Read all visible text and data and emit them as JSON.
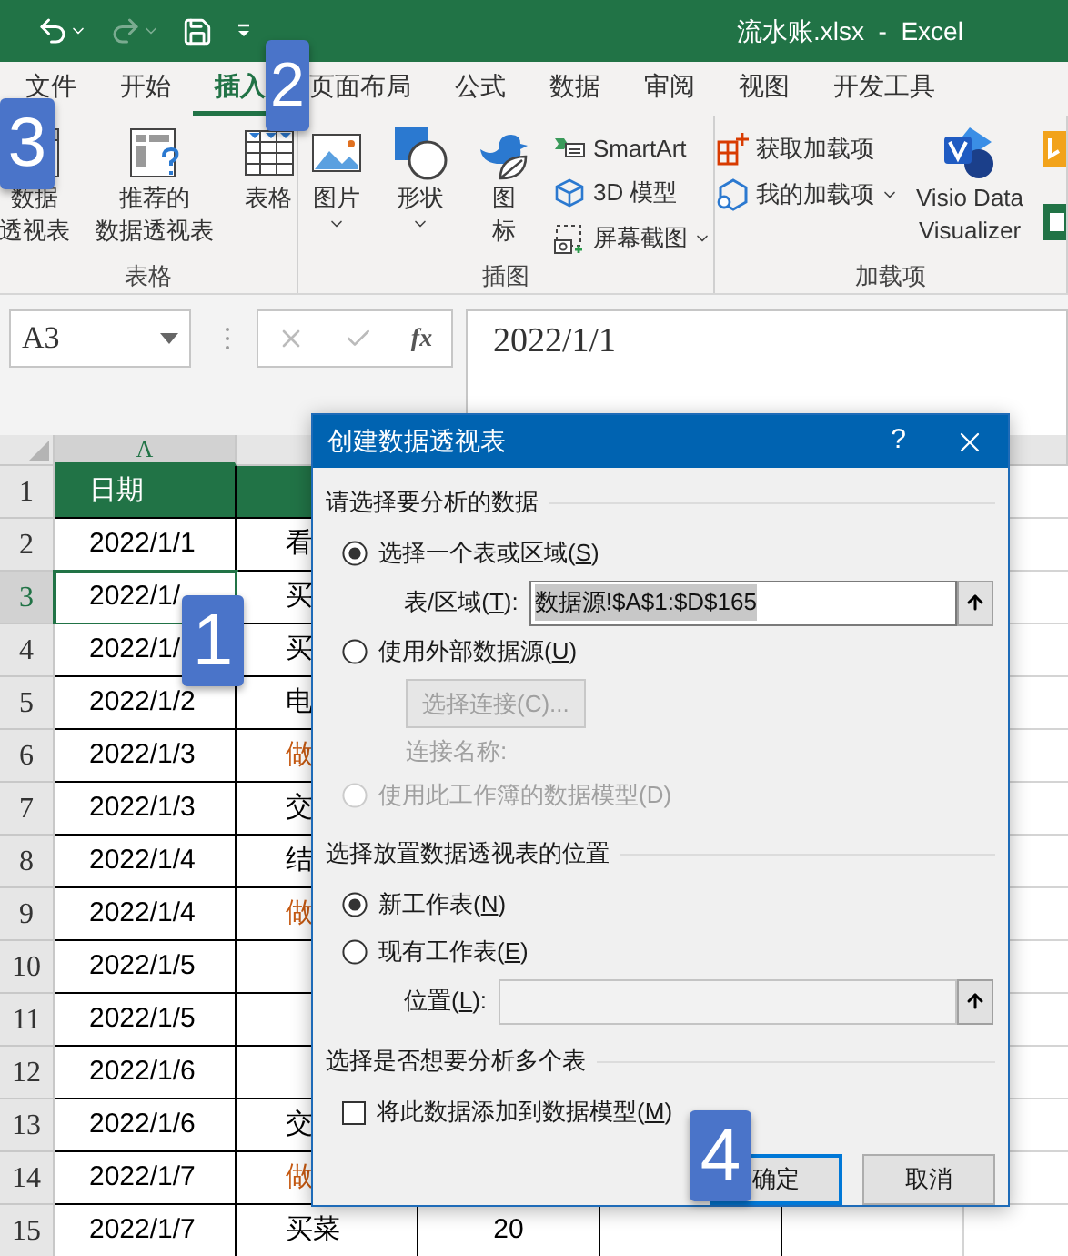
{
  "title_bar": {
    "title": "流水账.xlsx  -  Excel"
  },
  "quick_access": [
    {
      "kind": "undo",
      "disabled": false
    },
    {
      "kind": "redo",
      "disabled": true
    },
    {
      "kind": "save",
      "disabled": false
    },
    {
      "kind": "customize",
      "disabled": false
    }
  ],
  "tabs": [
    {
      "label": "文件",
      "selected": false
    },
    {
      "label": "开始",
      "selected": false
    },
    {
      "label": "插入",
      "selected": true
    },
    {
      "label": "页面布局",
      "selected": false
    },
    {
      "label": "公式",
      "selected": false
    },
    {
      "label": "数据",
      "selected": false
    },
    {
      "label": "审阅",
      "selected": false
    },
    {
      "label": "视图",
      "selected": false
    },
    {
      "label": "开发工具",
      "selected": false
    }
  ],
  "ribbon": {
    "groups": [
      {
        "label": "表格",
        "items": [
          {
            "kind": "large",
            "lines": [
              "数据",
              "透视表"
            ],
            "caret": false
          },
          {
            "kind": "large",
            "lines": [
              "推荐的",
              "数据透视表"
            ],
            "caret": false
          },
          {
            "kind": "large",
            "lines": [
              "表格"
            ],
            "caret": false
          }
        ]
      },
      {
        "label": "插图",
        "items": [
          {
            "kind": "large",
            "lines": [
              "图片"
            ],
            "caret": true
          },
          {
            "kind": "large",
            "lines": [
              "形状"
            ],
            "caret": true
          },
          {
            "kind": "large",
            "lines": [
              "图",
              "标"
            ],
            "caret": false
          },
          {
            "kind": "stack",
            "items": [
              {
                "label": "SmartArt",
                "caret": false
              },
              {
                "label": "3D 模型",
                "caret": false
              },
              {
                "label": "屏幕截图",
                "caret": true
              }
            ]
          }
        ]
      },
      {
        "label": "加载项",
        "items": [
          {
            "kind": "stack",
            "items": [
              {
                "label": "获取加载项",
                "caret": false
              },
              {
                "label": "我的加载项",
                "caret": true
              }
            ]
          },
          {
            "kind": "large",
            "lines": [
              "Visio Data",
              "Visualizer"
            ],
            "caret": false
          }
        ]
      }
    ]
  },
  "name_box": {
    "value": "A3"
  },
  "formula_bar": {
    "function_label": "fx",
    "value": "2022/1/1"
  },
  "sheet": {
    "columns": [
      {
        "label": "A",
        "selected": true
      }
    ],
    "rows": [
      {
        "number": "1",
        "kind": "header",
        "selected": false,
        "cells": [
          {
            "text": "日期"
          }
        ]
      },
      {
        "number": "2",
        "kind": "data",
        "selected": false,
        "cells": [
          {
            "text": "2022/1/1"
          },
          {
            "text": "看"
          }
        ]
      },
      {
        "number": "3",
        "kind": "data",
        "selected": true,
        "cells": [
          {
            "text": "2022/1/"
          },
          {
            "text": "买"
          }
        ]
      },
      {
        "number": "4",
        "kind": "data",
        "selected": false,
        "cells": [
          {
            "text": "2022/1/"
          },
          {
            "text": "买"
          }
        ]
      },
      {
        "number": "5",
        "kind": "data",
        "selected": false,
        "cells": [
          {
            "text": "2022/1/2"
          },
          {
            "text": "电"
          }
        ]
      },
      {
        "number": "6",
        "kind": "data",
        "selected": false,
        "cells": [
          {
            "text": "2022/1/3"
          },
          {
            "text": "做",
            "color": "#c65911"
          }
        ]
      },
      {
        "number": "7",
        "kind": "data",
        "selected": false,
        "cells": [
          {
            "text": "2022/1/3"
          },
          {
            "text": "交"
          }
        ]
      },
      {
        "number": "8",
        "kind": "data",
        "selected": false,
        "cells": [
          {
            "text": "2022/1/4"
          },
          {
            "text": "结"
          }
        ]
      },
      {
        "number": "9",
        "kind": "data",
        "selected": false,
        "cells": [
          {
            "text": "2022/1/4"
          },
          {
            "text": "做",
            "color": "#c65911"
          }
        ]
      },
      {
        "number": "10",
        "kind": "data",
        "selected": false,
        "cells": [
          {
            "text": "2022/1/5"
          }
        ]
      },
      {
        "number": "11",
        "kind": "data",
        "selected": false,
        "cells": [
          {
            "text": "2022/1/5"
          }
        ]
      },
      {
        "number": "12",
        "kind": "data",
        "selected": false,
        "cells": [
          {
            "text": "2022/1/6"
          }
        ]
      },
      {
        "number": "13",
        "kind": "data",
        "selected": false,
        "cells": [
          {
            "text": "2022/1/6"
          },
          {
            "text": "交"
          }
        ]
      },
      {
        "number": "14",
        "kind": "data",
        "selected": false,
        "cells": [
          {
            "text": "2022/1/7"
          },
          {
            "text": "做",
            "color": "#c65911"
          }
        ]
      },
      {
        "number": "15",
        "kind": "data",
        "selected": false,
        "cells": [
          {
            "text": "2022/1/7"
          },
          {
            "text": "买菜"
          },
          {
            "text": "20"
          }
        ]
      }
    ]
  },
  "dialog": {
    "title": "创建数据透视表",
    "help": "?",
    "sections": [
      {
        "heading": "请选择要分析的数据",
        "items": [
          {
            "kind": "radio",
            "label": "选择一个表或区域(",
            "key": "S",
            "label_end": ")",
            "selected": true,
            "disabled": false
          },
          {
            "kind": "field",
            "label": "表/区域(",
            "key": "T",
            "label_end": "):",
            "value": "数据源!$A$1:$D$165",
            "highlighted": true,
            "disabled": false
          },
          {
            "kind": "radio",
            "label": "使用外部数据源(",
            "key": "U",
            "label_end": ")",
            "selected": false,
            "disabled": false
          },
          {
            "kind": "button",
            "label": "选择连接(C)...",
            "disabled": true
          },
          {
            "kind": "note",
            "label": "连接名称:",
            "disabled": true
          },
          {
            "kind": "radio",
            "label": "使用此工作簿的数据模型(D)",
            "selected": false,
            "disabled": true
          }
        ]
      },
      {
        "heading": "选择放置数据透视表的位置",
        "items": [
          {
            "kind": "radio",
            "label": "新工作表(",
            "key": "N",
            "label_end": ")",
            "selected": true,
            "disabled": false
          },
          {
            "kind": "radio",
            "label": "现有工作表(",
            "key": "E",
            "label_end": ")",
            "selected": false,
            "disabled": false
          },
          {
            "kind": "field",
            "label": "位置(",
            "key": "L",
            "label_end": "):",
            "disabled": true
          }
        ]
      },
      {
        "heading": "选择是否想要分析多个表",
        "items": [
          {
            "kind": "checkbox",
            "label": "将此数据添加到数据模型(",
            "key": "M",
            "label_end": ")",
            "checked": false
          }
        ]
      }
    ],
    "buttons": [
      {
        "label": "确定",
        "default": true
      },
      {
        "label": "取消",
        "default": false
      }
    ]
  },
  "step_markers": [
    {
      "label": "1"
    },
    {
      "label": "2"
    },
    {
      "label": "3"
    },
    {
      "label": "4"
    }
  ]
}
